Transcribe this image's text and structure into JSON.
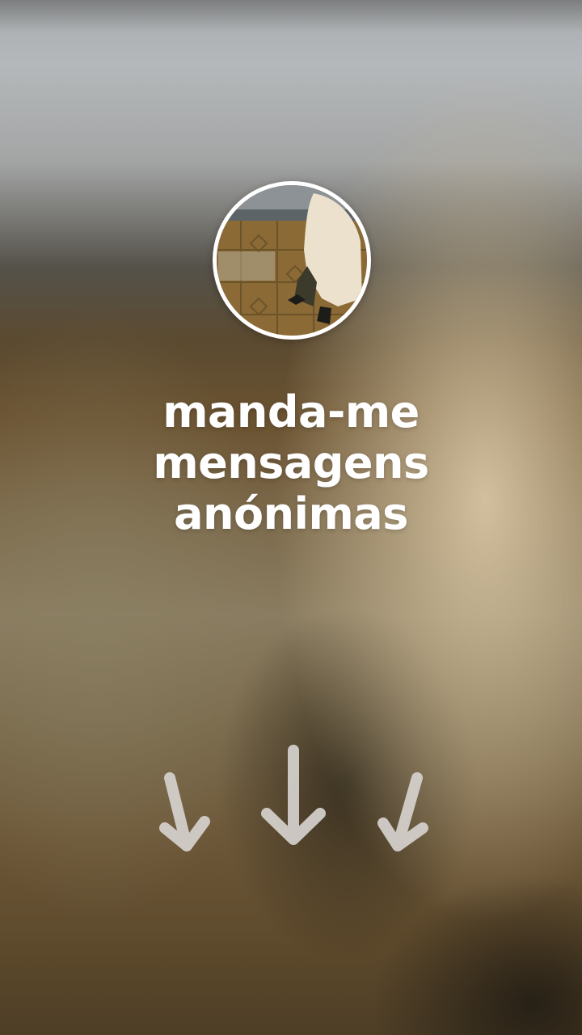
{
  "profile": {
    "avatar_icon": "profile-photo"
  },
  "prompt": {
    "lines": [
      "manda-me",
      "mensagens",
      "anónimas"
    ]
  },
  "arrows": {
    "icon": "down-arrow-icon",
    "count": 3,
    "color": "#d6d2ce"
  }
}
